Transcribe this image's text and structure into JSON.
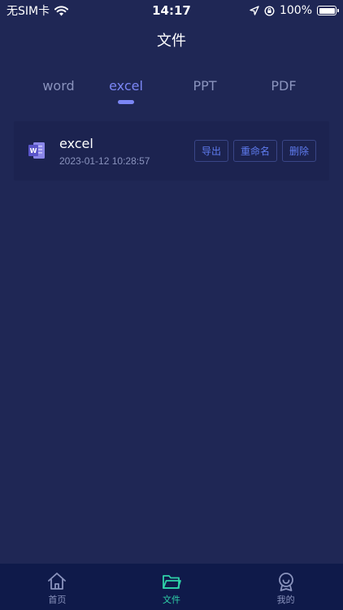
{
  "status_bar": {
    "carrier": "无SIM卡",
    "time": "14:17",
    "battery": "100%"
  },
  "page": {
    "title": "文件"
  },
  "tabs": [
    {
      "label": "word",
      "active": false
    },
    {
      "label": "excel",
      "active": true
    },
    {
      "label": "PPT",
      "active": false
    },
    {
      "label": "PDF",
      "active": false
    }
  ],
  "files": [
    {
      "name": "excel",
      "date": "2023-01-12 10:28:57",
      "icon": "word-document-icon",
      "actions": [
        "导出",
        "重命名",
        "删除"
      ]
    }
  ],
  "tabbar": {
    "items": [
      {
        "label": "首页",
        "icon": "home-icon",
        "active": false
      },
      {
        "label": "文件",
        "icon": "folder-icon",
        "active": true
      },
      {
        "label": "我的",
        "icon": "profile-badge-icon",
        "active": false
      }
    ]
  },
  "colors": {
    "background": "#1f2755",
    "accent": "#7b86f5",
    "tabbar_active": "#2fd1a8"
  }
}
